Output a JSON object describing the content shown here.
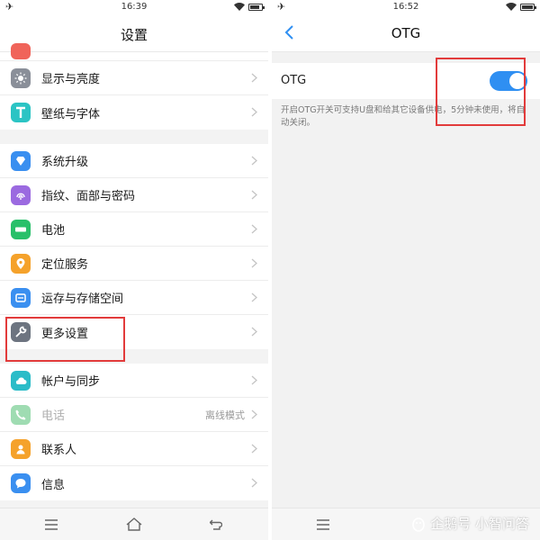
{
  "left": {
    "status": {
      "time": "16:39"
    },
    "title": "设置",
    "groups": [
      [
        {
          "label": "显示与亮度",
          "icon": "sun-icon",
          "color": "#8a8f99"
        },
        {
          "label": "壁纸与字体",
          "icon": "text-t-icon",
          "color": "#2bc4c4"
        }
      ],
      [
        {
          "label": "系统升级",
          "icon": "upgrade-icon",
          "color": "#3a8ff0"
        },
        {
          "label": "指纹、面部与密码",
          "icon": "fingerprint-icon",
          "color": "#9b6ae0"
        },
        {
          "label": "电池",
          "icon": "battery-icon",
          "color": "#28c06a"
        },
        {
          "label": "定位服务",
          "icon": "location-icon",
          "color": "#f5a22b"
        },
        {
          "label": "运存与存储空间",
          "icon": "storage-icon",
          "color": "#3a8ff0"
        },
        {
          "label": "更多设置",
          "icon": "wrench-icon",
          "color": "#6d7480"
        }
      ],
      [
        {
          "label": "帐户与同步",
          "icon": "cloud-icon",
          "color": "#2bbcc8"
        },
        {
          "label": "电话",
          "icon": "phone-icon",
          "color": "#9fdcb2",
          "value": "离线模式",
          "disabled": true
        },
        {
          "label": "联系人",
          "icon": "contact-icon",
          "color": "#f5a22b"
        },
        {
          "label": "信息",
          "icon": "message-icon",
          "color": "#3a8ff0"
        }
      ]
    ]
  },
  "right": {
    "status": {
      "time": "16:52"
    },
    "title": "OTG",
    "otg": {
      "label": "OTG",
      "enabled": true,
      "description": "开启OTG开关可支持U盘和给其它设备供电，5分钟未使用，将自动关闭。"
    }
  },
  "watermark": "企鹅号 小智问答"
}
